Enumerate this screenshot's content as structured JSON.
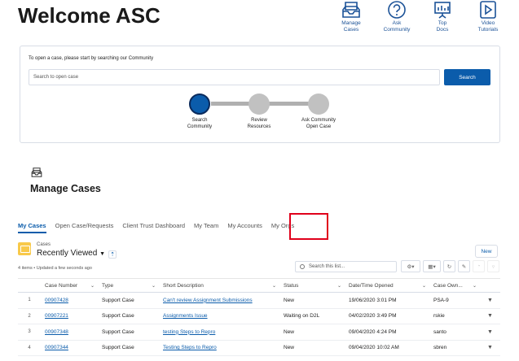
{
  "header": {
    "title": "Welcome ASC",
    "quick_links": [
      {
        "label_1": "Manage",
        "label_2": "Cases",
        "icon": "inbox-icon"
      },
      {
        "label_1": "Ask",
        "label_2": "Community",
        "icon": "question-icon"
      },
      {
        "label_1": "Top",
        "label_2": "Docs",
        "icon": "presentation-icon"
      },
      {
        "label_1": "Video",
        "label_2": "Tutorials",
        "icon": "play-icon"
      }
    ]
  },
  "search_card": {
    "hint": "To open a case, please start by searching our Community",
    "placeholder": "Search to open case",
    "button": "Search",
    "steps": [
      {
        "label_1": "Search",
        "label_2": "Community"
      },
      {
        "label_1": "Review",
        "label_2": "Resources"
      },
      {
        "label_1": "Ask Community",
        "label_2": "Open Case"
      }
    ]
  },
  "manage_cases": {
    "title": "Manage Cases"
  },
  "tabs": [
    "My Cases",
    "Open Case/Requests",
    "Client Trust Dashboard",
    "My Team",
    "My Accounts",
    "My Orgs"
  ],
  "list_view": {
    "object_name": "Cases",
    "view_name": "Recently Viewed",
    "meta": "4 items • Updated a few seconds ago",
    "new_button": "New",
    "search_placeholder": "Search this list...",
    "columns": [
      "Case Number",
      "Type",
      "Short Description",
      "Status",
      "Date/Time Opened",
      "Case Own..."
    ],
    "rows": [
      {
        "n": "1",
        "case": "00907428",
        "type": "Support Case",
        "desc": "Can't review Assignment Submissions",
        "status": "New",
        "opened": "19/06/2020 3:01 PM",
        "owner": "PSA-9"
      },
      {
        "n": "2",
        "case": "00907221",
        "type": "Support Case",
        "desc": "Assignments Issue",
        "status": "Waiting on D2L",
        "opened": "04/02/2020 3:49 PM",
        "owner": "rskie"
      },
      {
        "n": "3",
        "case": "00907348",
        "type": "Support Case",
        "desc": "testing Steps to Repro",
        "status": "New",
        "opened": "09/04/2020 4:24 PM",
        "owner": "santo"
      },
      {
        "n": "4",
        "case": "00907344",
        "type": "Support Case",
        "desc": "Testing Steps to Repro",
        "status": "New",
        "opened": "09/04/2020 10:02 AM",
        "owner": "sbren"
      }
    ]
  },
  "colors": {
    "brand": "#0b5cab",
    "highlight": "#e0001b",
    "cases_icon": "#f8c94a"
  }
}
